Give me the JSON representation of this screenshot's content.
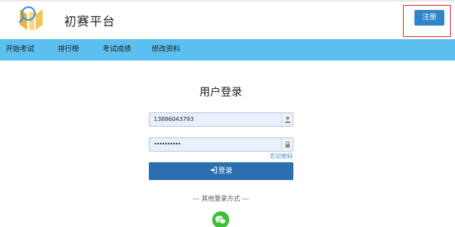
{
  "header": {
    "site_title": "初赛平台",
    "register_label": "注册",
    "logo_icon": "book-logo-icon"
  },
  "nav": {
    "items": [
      {
        "label": "开始考试"
      },
      {
        "label": "排行榜"
      },
      {
        "label": "考试成绩"
      },
      {
        "label": "修改资料"
      }
    ]
  },
  "login": {
    "title": "用户登录",
    "username_value": "13886043793",
    "username_icon": "user-icon",
    "password_value": "••••••••••",
    "password_icon": "lock-icon",
    "forgot_label": "忘记密码",
    "submit_label": "登录",
    "submit_icon": "sign-in-icon",
    "other_login_label": "--- 其他登录方式 ---",
    "wechat_icon": "wechat-icon"
  },
  "colors": {
    "nav_background": "#5bc0ef",
    "primary_button": "#2b6fb0",
    "register_button": "#2e86c8",
    "highlight_border": "#e31b23",
    "wechat_green": "#3dbf3a",
    "input_background": "#e8f0fe"
  }
}
